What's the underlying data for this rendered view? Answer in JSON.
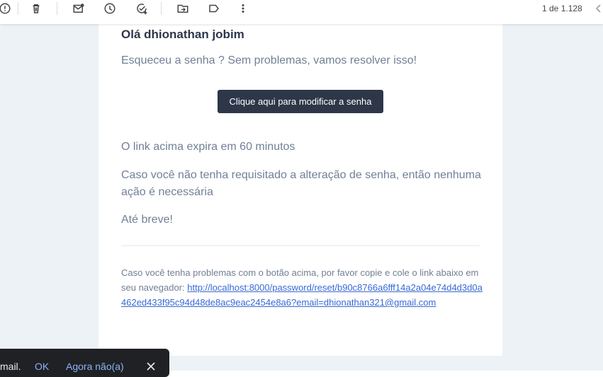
{
  "toolbar": {
    "pager_text": "1 de 1.128",
    "icons": [
      "report-spam-icon",
      "delete-icon",
      "mark-unread-icon",
      "snooze-icon",
      "add-task-icon",
      "move-to-icon",
      "label-icon",
      "more-vert-icon",
      "chevron-left-icon"
    ]
  },
  "email": {
    "greeting": "Olá dhionathan jobim",
    "intro": "Esqueceu a senha ? Sem problemas, vamos resolver isso!",
    "button_label": "Clique aqui para modificar a senha",
    "expiry": "O link acima expira em 60 minutos",
    "no_action": "Caso você não tenha requisitado a alteração de senha, então nenhuma ação é necessária",
    "farewell": "Até breve!",
    "subcopy_text": "Caso você tenha problemas com o botão acima, por favor copie e cole o link abaixo em seu navegador:",
    "subcopy_link": "http://localhost:8000/password/reset/b90c8766a6fff14a2a04e74d4d3d0a462ed433f95c94d48de8ac9eac2454e8a6?email=dhionathan321@gmail.com"
  },
  "snackbar": {
    "text": "mail.",
    "ok_label": "OK",
    "dismiss_label": "Agora não(a)"
  },
  "colors": {
    "button_bg": "#2d3748",
    "text_gray": "#718096",
    "link": "#3869d4",
    "snackbar_bg": "#202124",
    "snackbar_action": "#8ab4f8"
  }
}
